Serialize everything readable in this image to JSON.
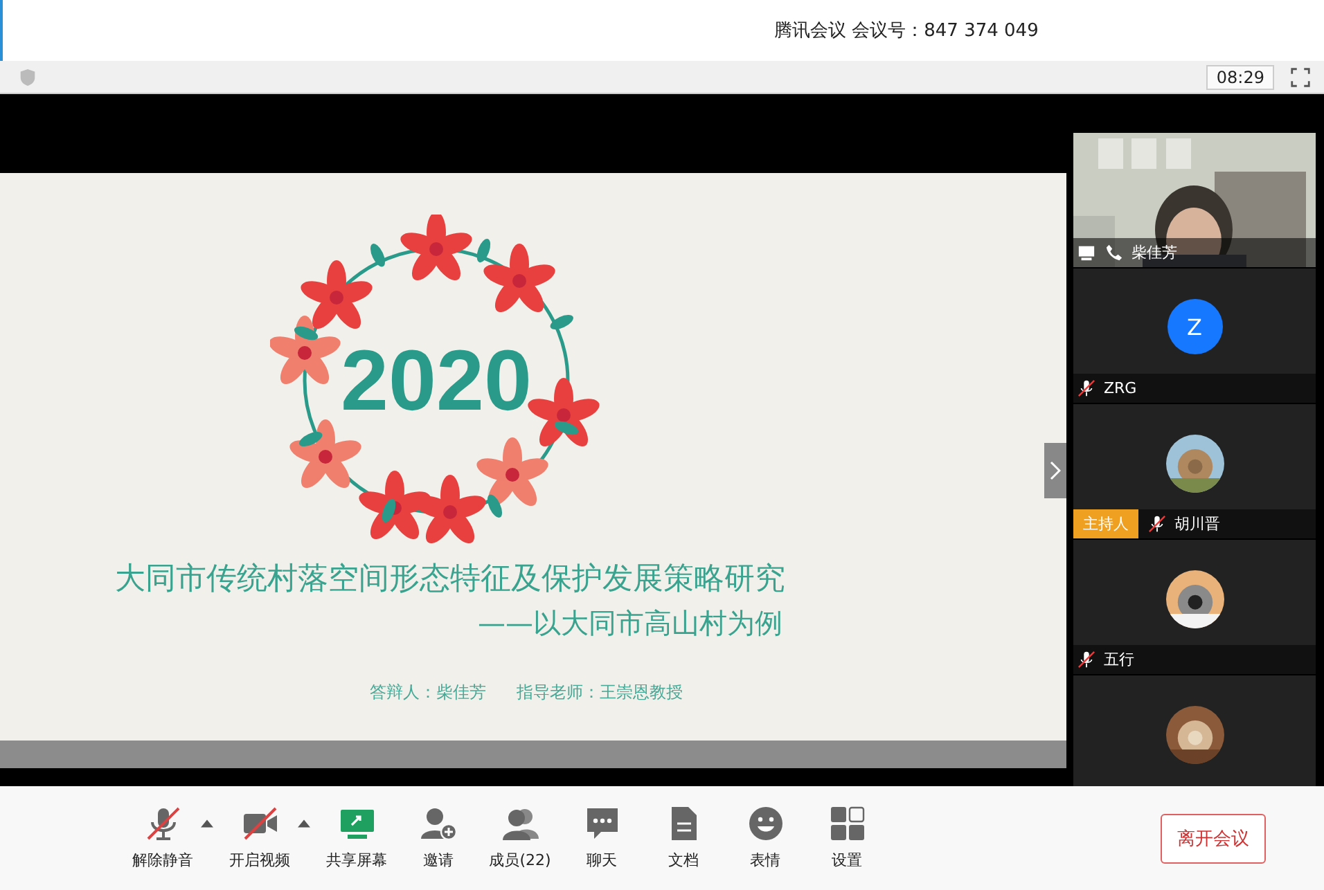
{
  "window": {
    "title": "腾讯会议 会议号：847 374 049"
  },
  "info_bar": {
    "timer": "08:29"
  },
  "slide": {
    "year": "2020",
    "title": "大同市传统村落空间形态特征及保护发展策略研究",
    "subtitle": "——以大同市高山村为例",
    "presenter": "答辩人：柴佳芳",
    "advisor": "指导老师：王崇恩教授"
  },
  "participants": [
    {
      "name": "柴佳芳",
      "kind": "video",
      "phone": true,
      "muted": false,
      "sharing": true,
      "host": false
    },
    {
      "name": "ZRG",
      "kind": "letter",
      "letter": "Z",
      "phone": false,
      "muted": true,
      "sharing": false,
      "host": false
    },
    {
      "name": "胡川晋",
      "kind": "picture",
      "phone": false,
      "muted": true,
      "sharing": false,
      "host": true,
      "host_label": "主持人"
    },
    {
      "name": "五行",
      "kind": "picture",
      "phone": false,
      "muted": true,
      "sharing": false,
      "host": false
    },
    {
      "kind": "picture"
    }
  ],
  "toolbar": [
    {
      "kind": "mic",
      "label": "解除静音",
      "off": true,
      "caret": true
    },
    {
      "kind": "camera",
      "label": "开启视频",
      "off": true,
      "caret": true
    },
    {
      "kind": "share",
      "label": "共享屏幕",
      "off": false,
      "caret": false
    },
    {
      "kind": "invite",
      "label": "邀请",
      "off": false,
      "caret": false
    },
    {
      "kind": "members",
      "label": "成员(22)",
      "off": false,
      "caret": false
    },
    {
      "kind": "chat",
      "label": "聊天",
      "off": false,
      "caret": false
    },
    {
      "kind": "doc",
      "label": "文档",
      "off": false,
      "caret": false
    },
    {
      "kind": "emoji",
      "label": "表情",
      "off": false,
      "caret": false
    },
    {
      "kind": "settings",
      "label": "设置",
      "off": false,
      "caret": false
    }
  ],
  "leave_button": "离开会议"
}
